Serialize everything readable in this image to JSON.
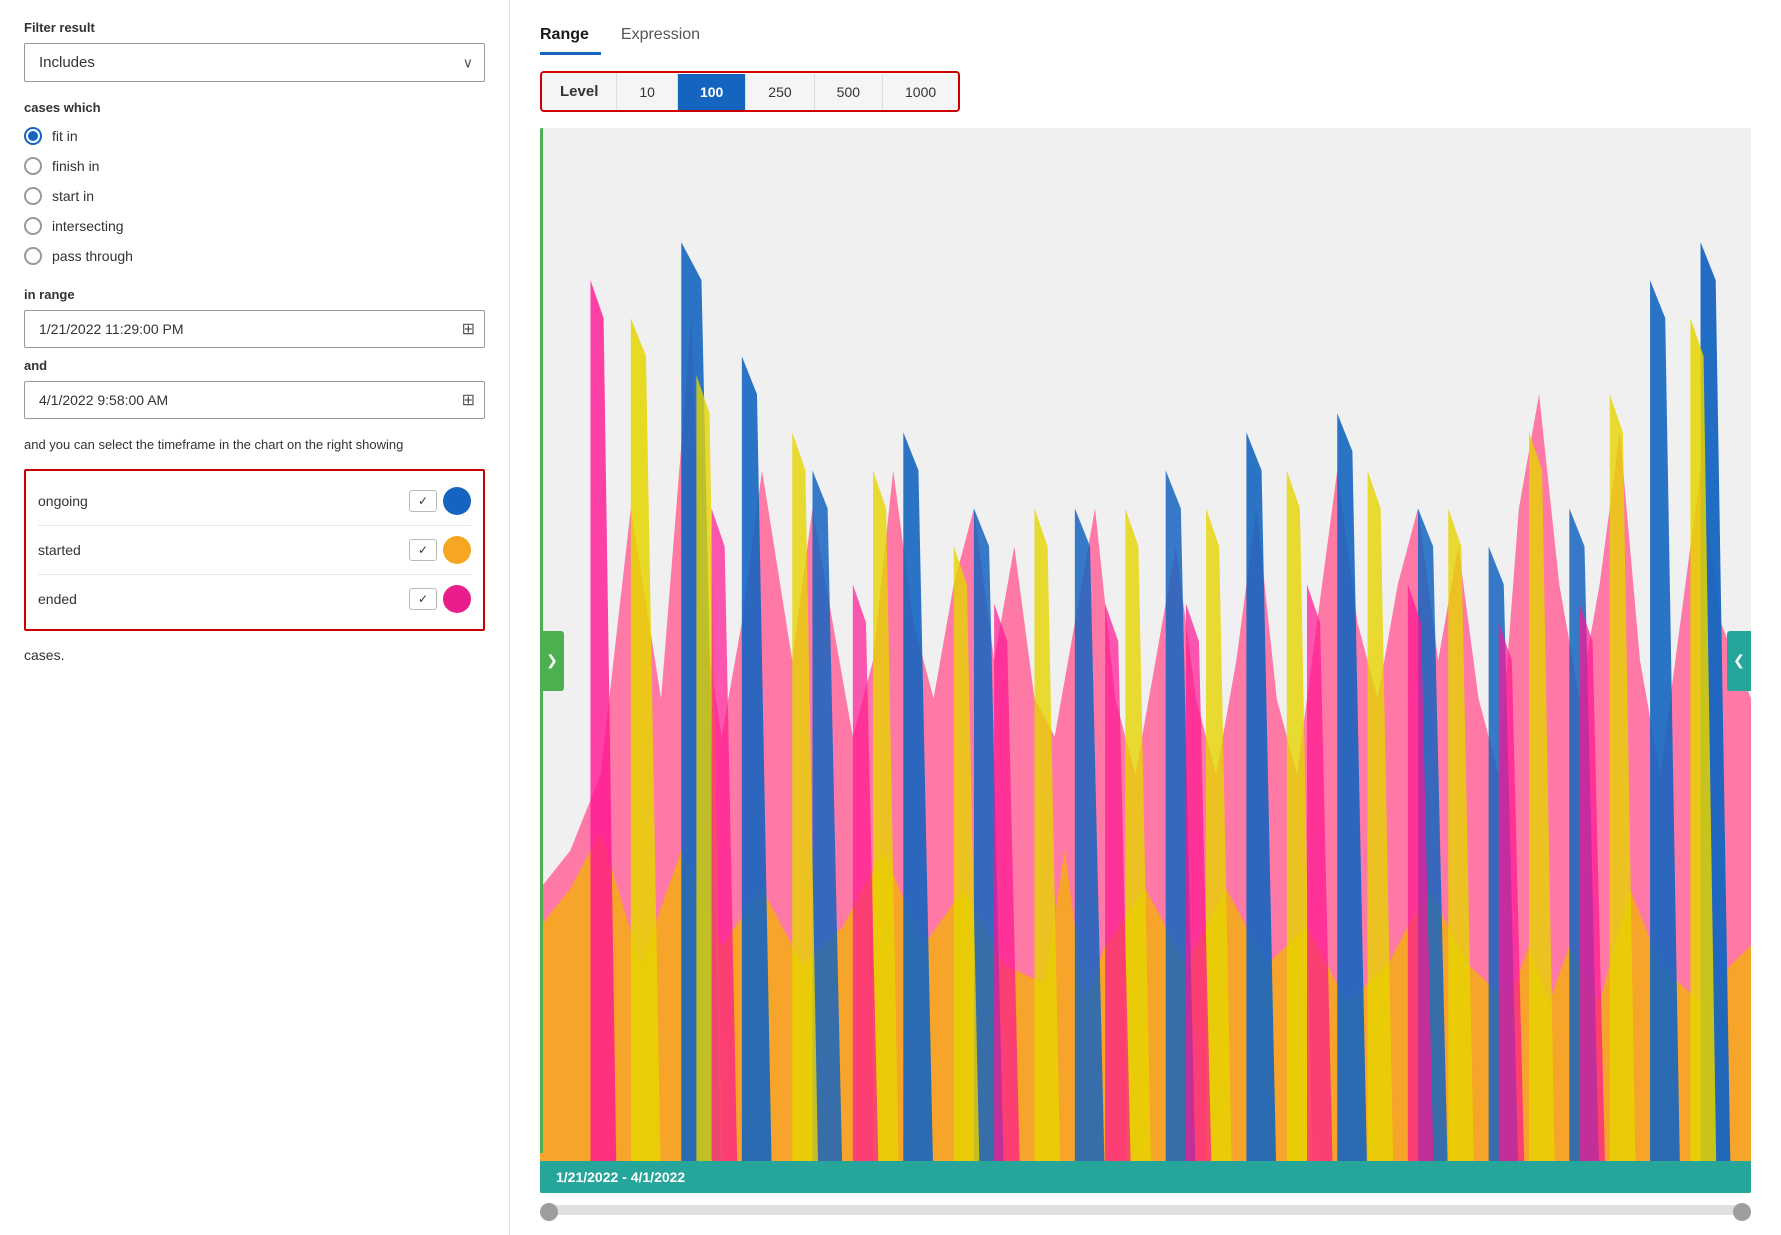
{
  "left": {
    "filter_result_label": "Filter result",
    "dropdown_value": "Includes",
    "dropdown_placeholder": "Includes",
    "cases_which_label": "cases which",
    "radio_options": [
      {
        "id": "fit_in",
        "label": "fit in",
        "selected": true
      },
      {
        "id": "finish_in",
        "label": "finish in",
        "selected": false
      },
      {
        "id": "start_in",
        "label": "start in",
        "selected": false
      },
      {
        "id": "intersecting",
        "label": "intersecting",
        "selected": false
      },
      {
        "id": "pass_through",
        "label": "pass through",
        "selected": false
      }
    ],
    "in_range_label": "in range",
    "date_start": "1/21/2022 11:29:00 PM",
    "and_label": "and",
    "date_end": "4/1/2022 9:58:00 AM",
    "timeframe_text": "and you can select the timeframe in the chart on the right showing",
    "toggles": [
      {
        "id": "ongoing",
        "label": "ongoing",
        "checked": true,
        "color": "#1565c0"
      },
      {
        "id": "started",
        "label": "started",
        "checked": true,
        "color": "#f5a623"
      },
      {
        "id": "ended",
        "label": "ended",
        "checked": true,
        "color": "#e91e8c"
      }
    ],
    "cases_label": "cases."
  },
  "right": {
    "tabs": [
      {
        "id": "range",
        "label": "Range",
        "active": true
      },
      {
        "id": "expression",
        "label": "Expression",
        "active": false
      }
    ],
    "level_label": "Level",
    "level_options": [
      {
        "value": "10",
        "active": false
      },
      {
        "value": "100",
        "active": true
      },
      {
        "value": "250",
        "active": false
      },
      {
        "value": "500",
        "active": false
      },
      {
        "value": "1000",
        "active": false
      }
    ],
    "date_range_banner": "1/21/2022 - 4/1/2022",
    "nav_left_icon": "❯",
    "nav_right_icon": "❮"
  }
}
